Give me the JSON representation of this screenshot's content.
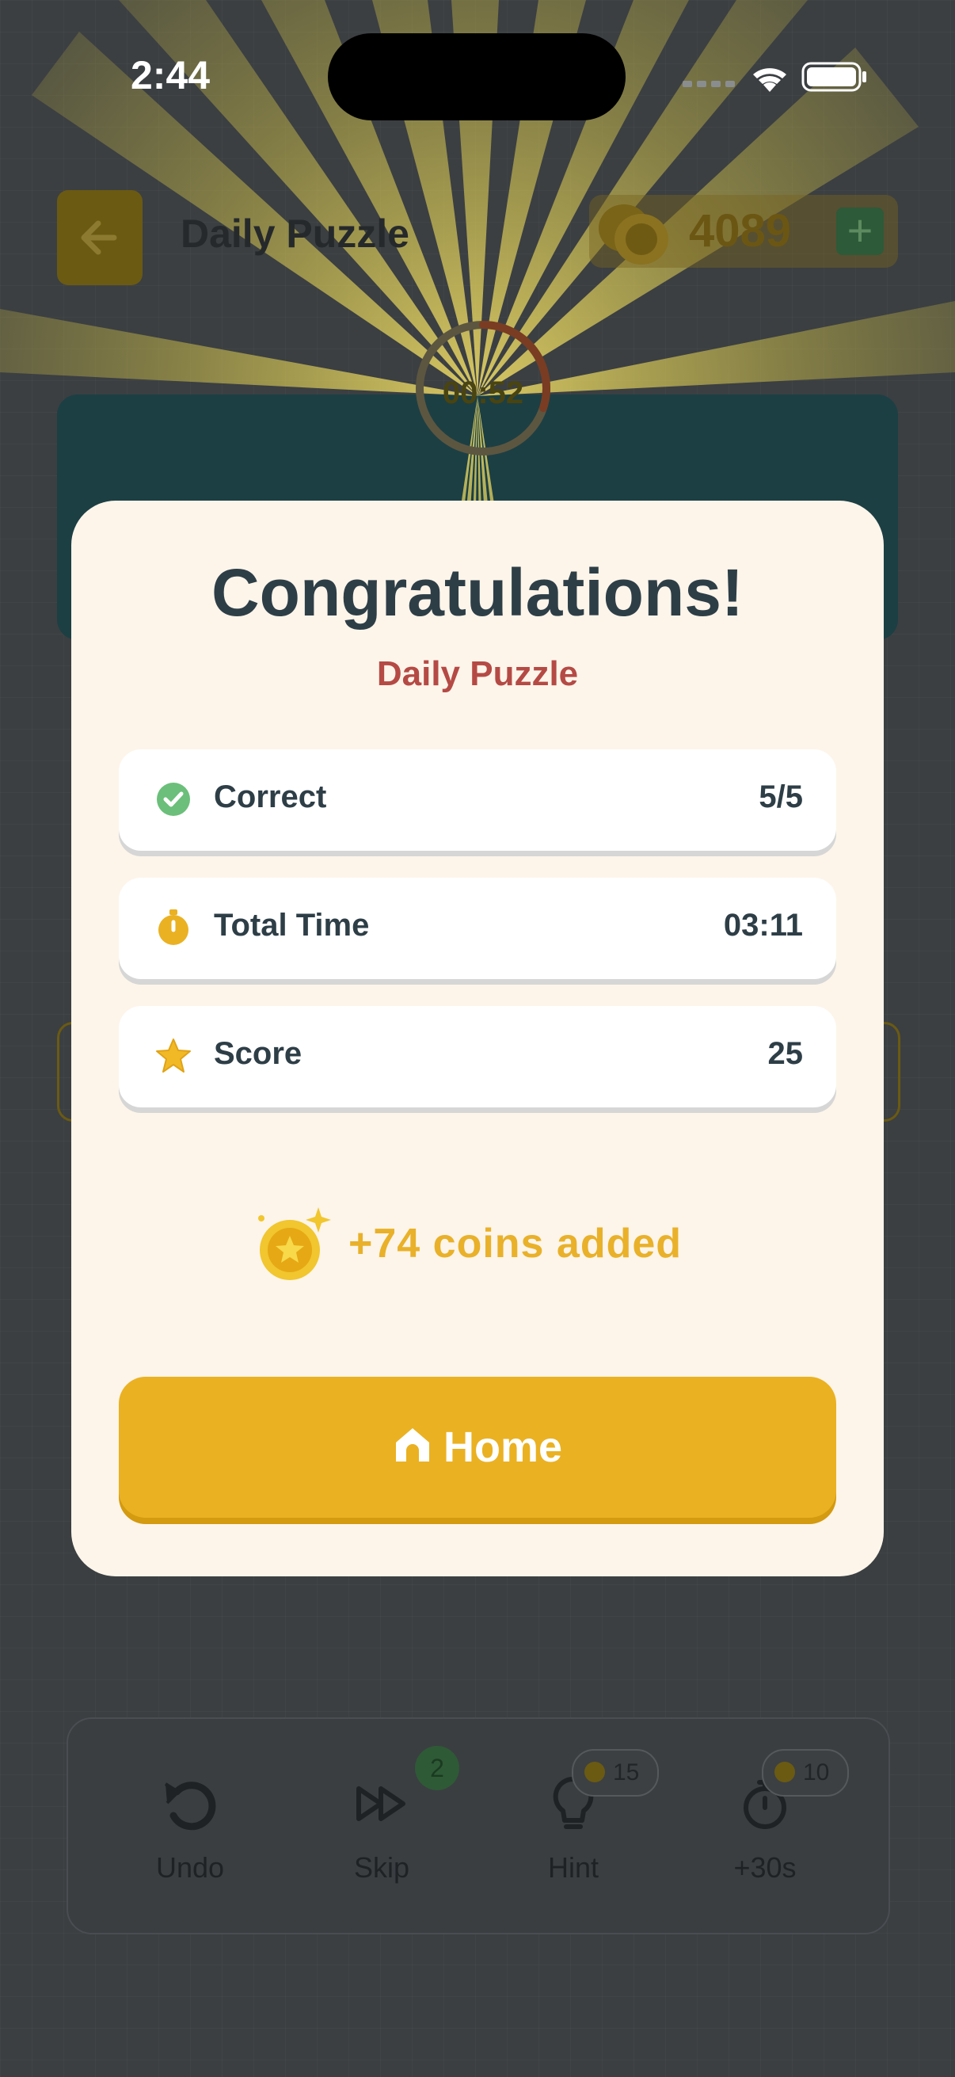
{
  "status_bar": {
    "time": "2:44"
  },
  "background_screen": {
    "title": "Daily Puzzle",
    "coins": "4089",
    "plus_label": "+",
    "timer": "00:52",
    "toolbar": [
      {
        "label": "Undo",
        "icon": "undo-icon"
      },
      {
        "label": "Skip",
        "icon": "skip-icon",
        "badge": "2"
      },
      {
        "label": "Hint",
        "icon": "lightbulb-icon",
        "cost": "15"
      },
      {
        "label": "+30s",
        "icon": "stopwatch-icon",
        "cost": "10"
      }
    ]
  },
  "modal": {
    "title": "Congratulations!",
    "subtitle": "Daily Puzzle",
    "stats": [
      {
        "label": "Correct",
        "value": "5/5",
        "icon": "check-circle-icon"
      },
      {
        "label": "Total Time",
        "value": "03:11",
        "icon": "stopwatch-icon"
      },
      {
        "label": "Score",
        "value": "25",
        "icon": "star-icon"
      }
    ],
    "reward": "+74 coins added",
    "home_button": "Home"
  },
  "colors": {
    "accent": "#eab122",
    "title": "#2e3e47",
    "subtitle": "#b54a45",
    "modal_bg": "#fdf5ea",
    "success": "#6bbf7a"
  }
}
